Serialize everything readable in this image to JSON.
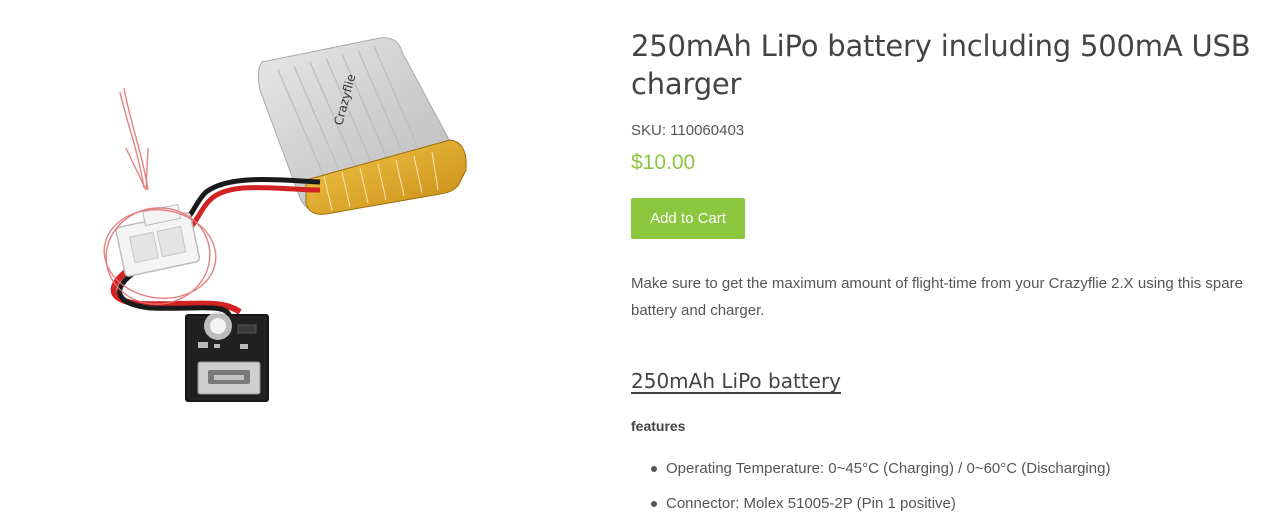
{
  "product": {
    "title": "250mAh LiPo battery including 500mA USB charger",
    "sku": "SKU: 110060403",
    "price": "$10.00",
    "add_to_cart_label": "Add to Cart",
    "description": "Make sure to get the maximum amount of flight-time from your Crazyflie 2.X using this spare battery and charger.",
    "image": {
      "battery_label": "Crazyflie"
    }
  },
  "section": {
    "heading": "250mAh LiPo battery",
    "features_label": "features",
    "features": [
      "Operating Temperature: 0~45°C (Charging) / 0~60°C (Discharging)",
      "Connector: Molex 51005-2P (Pin 1 positive)"
    ]
  },
  "colors": {
    "accent": "#8cc63f",
    "text": "#555555",
    "heading": "#444444"
  }
}
